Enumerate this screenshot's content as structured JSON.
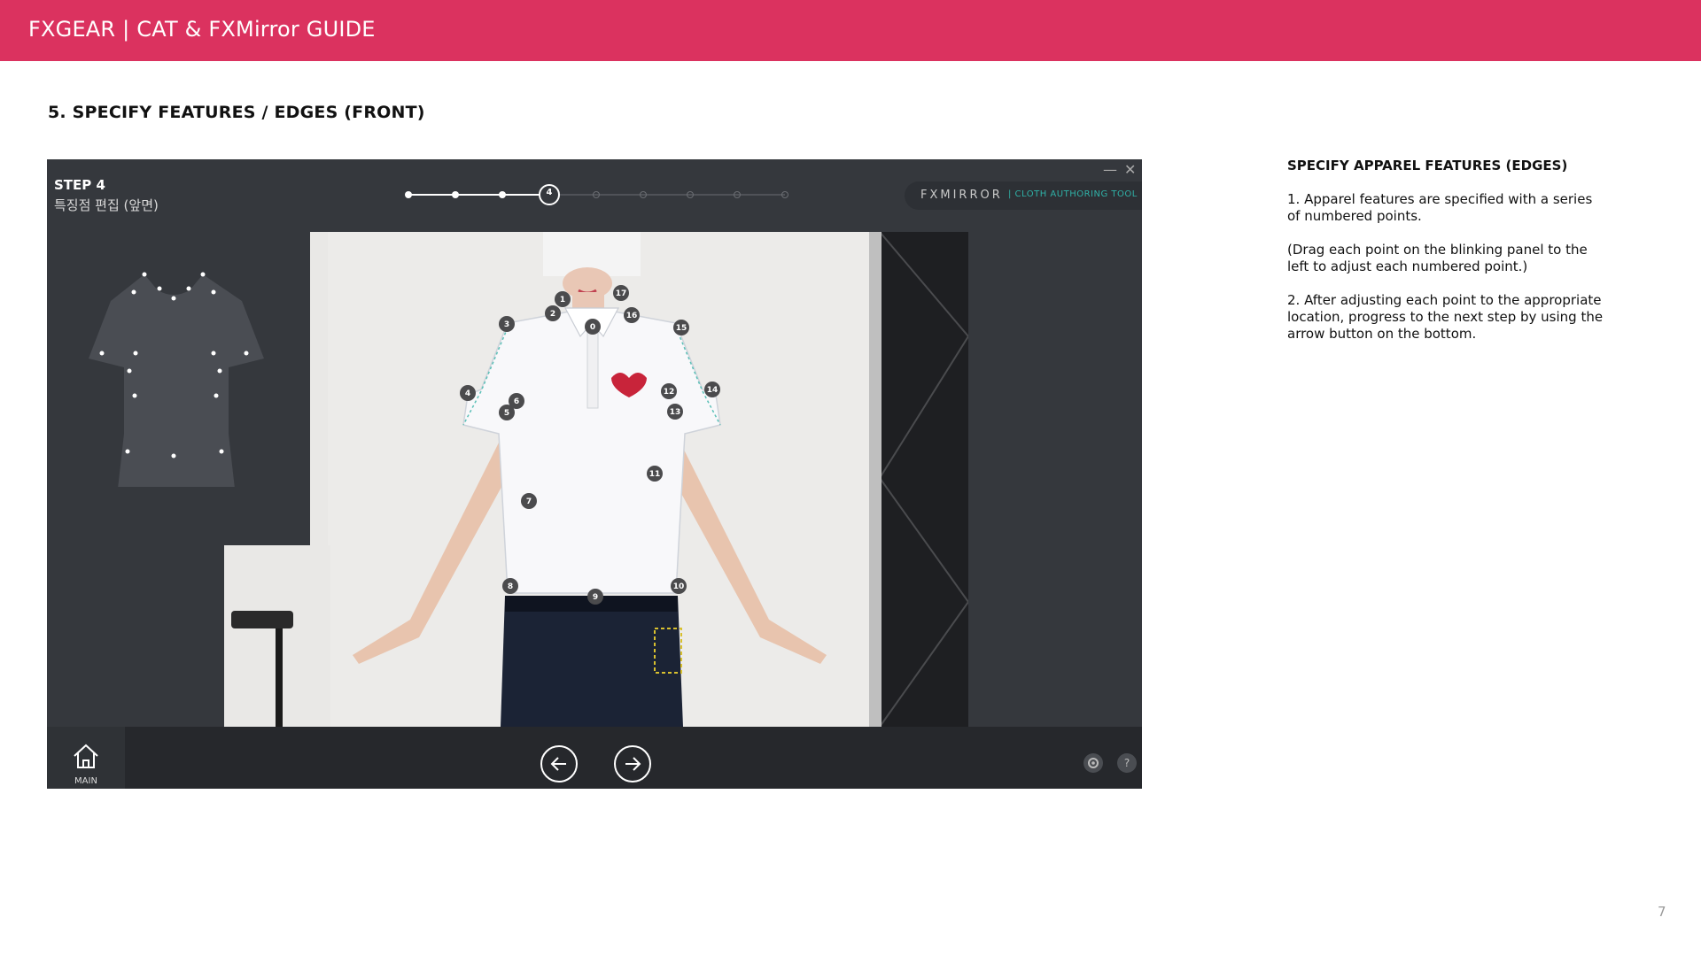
{
  "header": {
    "title": "FXGEAR | CAT & FXMirror GUIDE"
  },
  "section": {
    "title": "5. SPECIFY FEATURES / EDGES (FRONT)"
  },
  "app": {
    "step_label": "STEP 4",
    "step_subtitle": "특징점 편집 (앞면)",
    "current_step": "4",
    "brand_main": "FXMIRROR",
    "brand_sub": "| CLOTH AUTHORING TOOL",
    "minimize_glyph": "—",
    "close_glyph": "✕",
    "home_label": "MAIN",
    "help_glyph": "?",
    "point_labels": [
      "0",
      "1",
      "2",
      "3",
      "4",
      "5",
      "6",
      "7",
      "8",
      "9",
      "10",
      "11",
      "12",
      "13",
      "14",
      "15",
      "16",
      "17"
    ],
    "colors": {
      "accent": "#db325f",
      "brand_teal": "#2fb1a7",
      "panel_bg": "#35383d"
    }
  },
  "guide": {
    "heading": "SPECIFY APPAREL FEATURES (EDGES)",
    "p1": "1. Apparel features are specified with a series of numbered points.",
    "p2": "(Drag each point on the blinking panel to the left to adjust each numbered point.)",
    "p3": "2. After adjusting each point to the appropriate location, progress to the next step by using the arrow button on the bottom."
  },
  "page": {
    "number": "7"
  }
}
